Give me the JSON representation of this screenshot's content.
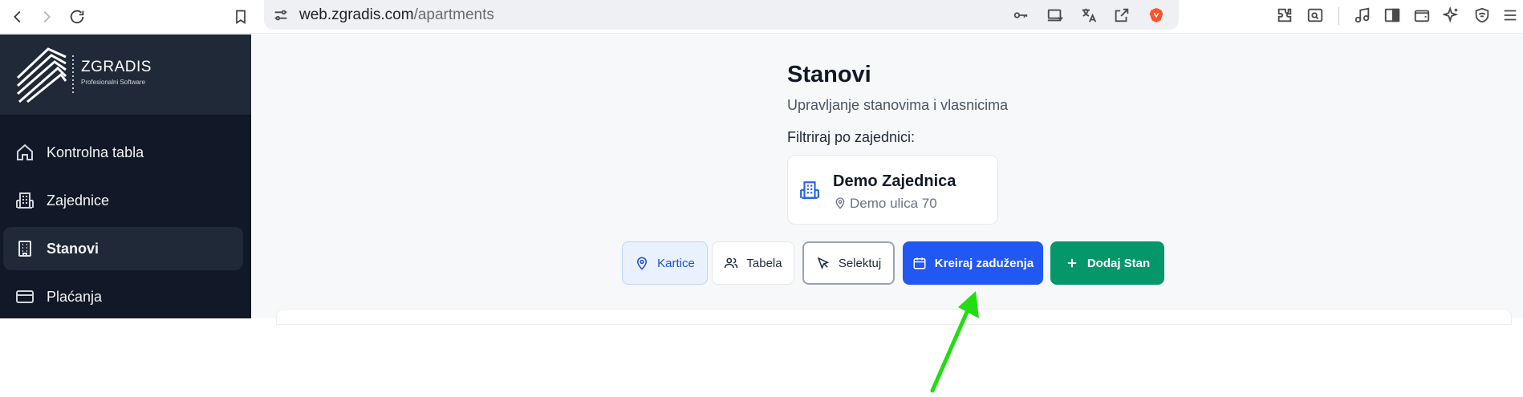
{
  "browser": {
    "url_host": "web.zgradis.com",
    "url_path": "/apartments"
  },
  "sidebar": {
    "brand": "ZGRADIS",
    "tagline": "Profesionalni Software",
    "items": [
      {
        "label": "Kontrolna tabla",
        "icon": "home-icon"
      },
      {
        "label": "Zajednice",
        "icon": "building-icon"
      },
      {
        "label": "Stanovi",
        "icon": "apartment-building-icon",
        "active": true
      },
      {
        "label": "Plaćanja",
        "icon": "credit-card-icon"
      }
    ]
  },
  "main": {
    "title": "Stanovi",
    "subtitle": "Upravljanje stanovima i vlasnicima",
    "filter_label": "Filtriraj po zajednici:",
    "community": {
      "name": "Demo Zajednica",
      "address": "Demo ulica 70"
    },
    "buttons": {
      "kartice": "Kartice",
      "tabela": "Tabela",
      "selektuj": "Selektuj",
      "kreiraj": "Kreiraj zaduženja",
      "dodaj": "Dodaj Stan"
    }
  },
  "colors": {
    "sidebar_bg": "#111827",
    "primary_blue": "#2157f2",
    "green": "#059669",
    "annotation_arrow": "#22dd11"
  }
}
